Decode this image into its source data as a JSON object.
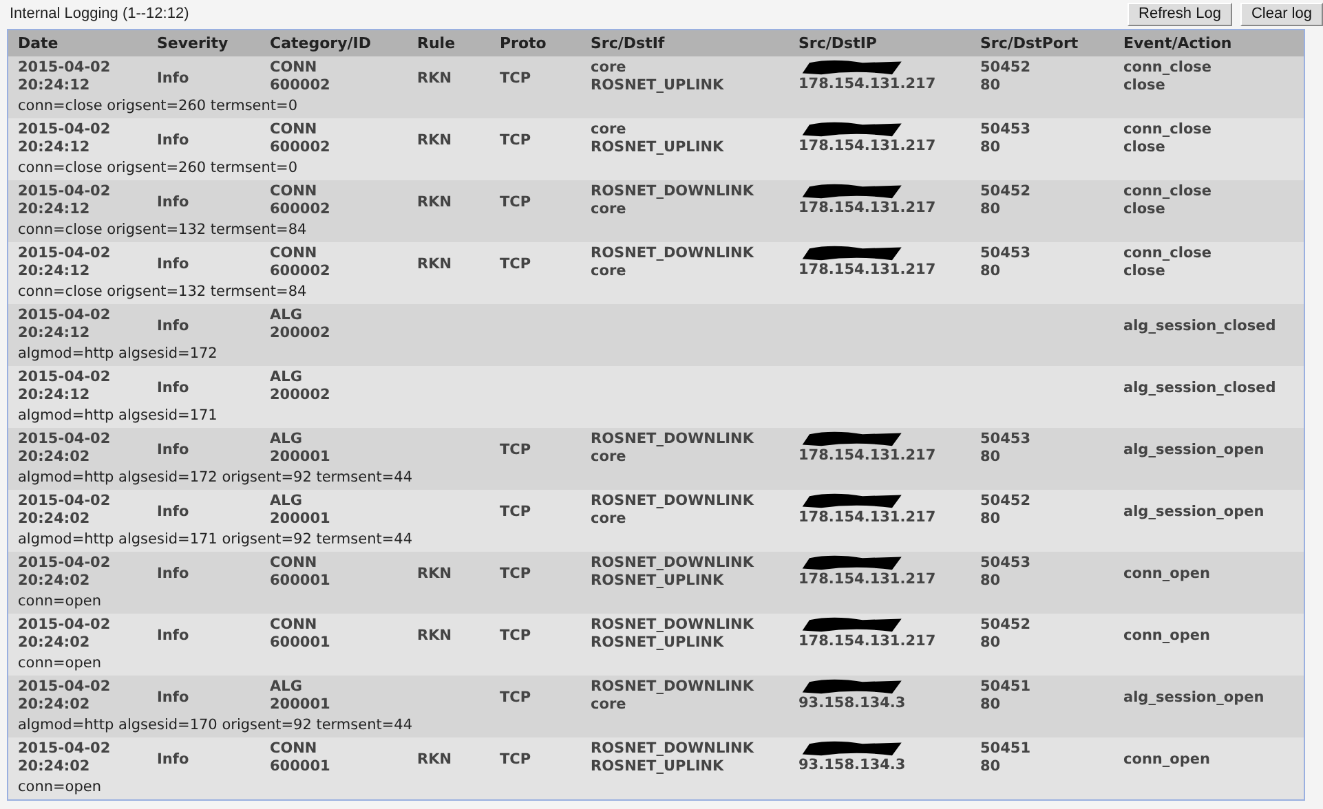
{
  "title": "Internal Logging (1--12:12)",
  "buttons": [
    "Refresh Log",
    "Clear log"
  ],
  "columns": [
    "Date",
    "Severity",
    "Category/ID",
    "Rule",
    "Proto",
    "Src/DstIf",
    "Src/DstIP",
    "Src/DstPort",
    "Event/Action"
  ],
  "rows": [
    {
      "date": "2015-04-02",
      "time": "20:24:12",
      "severity": "Info",
      "category": "CONN",
      "id": "600002",
      "rule": "RKN",
      "proto": "TCP",
      "src_if": "core",
      "dst_if": "ROSNET_UPLINK",
      "src_ip_redacted": true,
      "dst_ip": "178.154.131.217",
      "src_port": "50452",
      "dst_port": "80",
      "event": "conn_close",
      "action": "close",
      "detail": "conn=close origsent=260 termsent=0"
    },
    {
      "date": "2015-04-02",
      "time": "20:24:12",
      "severity": "Info",
      "category": "CONN",
      "id": "600002",
      "rule": "RKN",
      "proto": "TCP",
      "src_if": "core",
      "dst_if": "ROSNET_UPLINK",
      "src_ip_redacted": true,
      "dst_ip": "178.154.131.217",
      "src_port": "50453",
      "dst_port": "80",
      "event": "conn_close",
      "action": "close",
      "detail": "conn=close origsent=260 termsent=0"
    },
    {
      "date": "2015-04-02",
      "time": "20:24:12",
      "severity": "Info",
      "category": "CONN",
      "id": "600002",
      "rule": "RKN",
      "proto": "TCP",
      "src_if": "ROSNET_DOWNLINK",
      "dst_if": "core",
      "src_ip_redacted": true,
      "dst_ip": "178.154.131.217",
      "src_port": "50452",
      "dst_port": "80",
      "event": "conn_close",
      "action": "close",
      "detail": "conn=close origsent=132 termsent=84"
    },
    {
      "date": "2015-04-02",
      "time": "20:24:12",
      "severity": "Info",
      "category": "CONN",
      "id": "600002",
      "rule": "RKN",
      "proto": "TCP",
      "src_if": "ROSNET_DOWNLINK",
      "dst_if": "core",
      "src_ip_redacted": true,
      "dst_ip": "178.154.131.217",
      "src_port": "50453",
      "dst_port": "80",
      "event": "conn_close",
      "action": "close",
      "detail": "conn=close origsent=132 termsent=84"
    },
    {
      "date": "2015-04-02",
      "time": "20:24:12",
      "severity": "Info",
      "category": "ALG",
      "id": "200002",
      "event": "alg_session_closed",
      "detail": "algmod=http algsesid=172"
    },
    {
      "date": "2015-04-02",
      "time": "20:24:12",
      "severity": "Info",
      "category": "ALG",
      "id": "200002",
      "event": "alg_session_closed",
      "detail": "algmod=http algsesid=171"
    },
    {
      "date": "2015-04-02",
      "time": "20:24:02",
      "severity": "Info",
      "category": "ALG",
      "id": "200001",
      "proto": "TCP",
      "src_if": "ROSNET_DOWNLINK",
      "dst_if": "core",
      "src_ip_redacted": true,
      "dst_ip": "178.154.131.217",
      "src_port": "50453",
      "dst_port": "80",
      "event": "alg_session_open",
      "detail": "algmod=http algsesid=172 origsent=92 termsent=44"
    },
    {
      "date": "2015-04-02",
      "time": "20:24:02",
      "severity": "Info",
      "category": "ALG",
      "id": "200001",
      "proto": "TCP",
      "src_if": "ROSNET_DOWNLINK",
      "dst_if": "core",
      "src_ip_redacted": true,
      "dst_ip": "178.154.131.217",
      "src_port": "50452",
      "dst_port": "80",
      "event": "alg_session_open",
      "detail": "algmod=http algsesid=171 origsent=92 termsent=44"
    },
    {
      "date": "2015-04-02",
      "time": "20:24:02",
      "severity": "Info",
      "category": "CONN",
      "id": "600001",
      "rule": "RKN",
      "proto": "TCP",
      "src_if": "ROSNET_DOWNLINK",
      "dst_if": "ROSNET_UPLINK",
      "src_ip_redacted": true,
      "dst_ip": "178.154.131.217",
      "src_port": "50453",
      "dst_port": "80",
      "event": "conn_open",
      "detail": "conn=open"
    },
    {
      "date": "2015-04-02",
      "time": "20:24:02",
      "severity": "Info",
      "category": "CONN",
      "id": "600001",
      "rule": "RKN",
      "proto": "TCP",
      "src_if": "ROSNET_DOWNLINK",
      "dst_if": "ROSNET_UPLINK",
      "src_ip_redacted": true,
      "dst_ip": "178.154.131.217",
      "src_port": "50452",
      "dst_port": "80",
      "event": "conn_open",
      "detail": "conn=open"
    },
    {
      "date": "2015-04-02",
      "time": "20:24:02",
      "severity": "Info",
      "category": "ALG",
      "id": "200001",
      "proto": "TCP",
      "src_if": "ROSNET_DOWNLINK",
      "dst_if": "core",
      "src_ip_redacted": true,
      "dst_ip": "93.158.134.3",
      "src_port": "50451",
      "dst_port": "80",
      "event": "alg_session_open",
      "detail": "algmod=http algsesid=170 origsent=92 termsent=44"
    },
    {
      "date": "2015-04-02",
      "time": "20:24:02",
      "severity": "Info",
      "category": "CONN",
      "id": "600001",
      "rule": "RKN",
      "proto": "TCP",
      "src_if": "ROSNET_DOWNLINK",
      "dst_if": "ROSNET_UPLINK",
      "src_ip_redacted": true,
      "dst_ip": "93.158.134.3",
      "src_port": "50451",
      "dst_port": "80",
      "event": "conn_open",
      "detail": "conn=open"
    }
  ]
}
